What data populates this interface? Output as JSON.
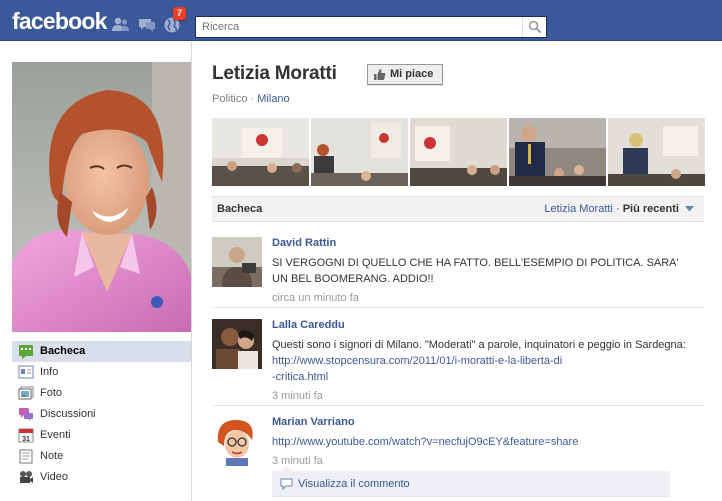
{
  "topbar": {
    "logo": "facebook",
    "notification_count": "7",
    "search_placeholder": "Ricerca",
    "colors": {
      "bar": "#3b5998",
      "badge": "#f03d25"
    },
    "icons": [
      "friend-requests-icon",
      "messages-icon",
      "notifications-globe-icon",
      "search-icon"
    ]
  },
  "profile": {
    "name": "Letizia Moratti",
    "like_label": "Mi piace",
    "category": "Politico",
    "separator": "·",
    "city": "Milano"
  },
  "sidebar": {
    "items": [
      {
        "label": "Bacheca",
        "icon": "wall-icon",
        "active": true
      },
      {
        "label": "Info",
        "icon": "info-icon",
        "active": false
      },
      {
        "label": "Foto",
        "icon": "photos-icon",
        "active": false
      },
      {
        "label": "Discussioni",
        "icon": "discussions-icon",
        "active": false
      },
      {
        "label": "Eventi",
        "icon": "events-calendar-icon",
        "active": false
      },
      {
        "label": "Note",
        "icon": "notes-icon",
        "active": false
      },
      {
        "label": "Video",
        "icon": "video-icon",
        "active": false
      }
    ]
  },
  "wall": {
    "title": "Bacheca",
    "filter_who": "Letizia Moratti",
    "filter_sep": "·",
    "filter_recent": "Più recenti"
  },
  "stories": [
    {
      "author": "David Rattin",
      "message": "SI VERGOGNI DI QUELLO CHE HA FATTO. BELL'ESEMPIO DI POLITICA. SARA' UN BEL BOOMERANG. ADDIO!!",
      "time": "circa un minuto fa"
    },
    {
      "author": "Lalla Careddu",
      "message_text": "Questi sono i signori di Milano. \"Moderati\" a parole, inquinatori e peggio in Sardegna: ",
      "message_link": "http://www.stopcensura.com/2011/01/i-moratti-e-la-liberta-di-critica.html",
      "message_link_line1": "http://www.stopcensura.com/2011/01/i-moratti-e-la-liberta-di",
      "message_link_line2": "-critica.html",
      "time": "3 minuti fa"
    },
    {
      "author": "Marian Varriano",
      "message_link": "http://www.youtube.com/watch?v=necfujO9cEY&feature=share",
      "time": "3 minuti fa",
      "comment_label": "Visualizza il commento"
    }
  ]
}
